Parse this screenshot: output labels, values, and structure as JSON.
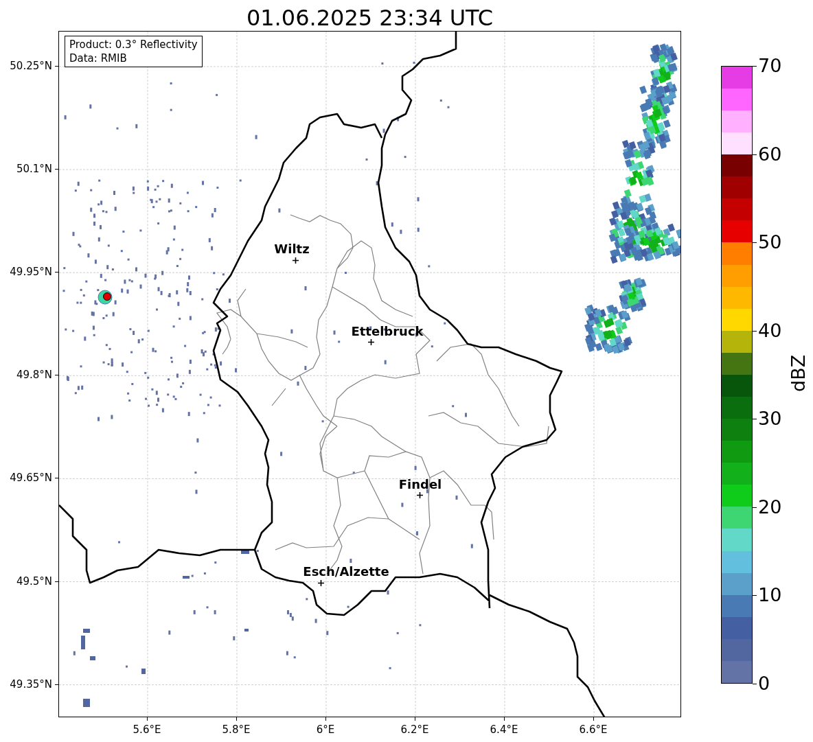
{
  "figure": {
    "title": "01.06.2025 23:34 UTC"
  },
  "map": {
    "info_box": [
      "Product: 0.3° Reflectivity",
      "Data: RMIB"
    ],
    "x_ticks": [
      "5.6°E",
      "5.8°E",
      "6°E",
      "6.2°E",
      "6.4°E",
      "6.6°E"
    ],
    "y_ticks": [
      "50.25°N",
      "50.1°N",
      "49.95°N",
      "49.8°N",
      "49.65°N",
      "49.5°N",
      "49.35°N"
    ],
    "cities": [
      {
        "name": "Wiltz"
      },
      {
        "name": "Ettelbruck"
      },
      {
        "name": "Findel"
      },
      {
        "name": "Esch/Alzette"
      }
    ]
  },
  "colorbar": {
    "label": "dBZ",
    "ticks": [
      "70",
      "60",
      "50",
      "40",
      "30",
      "20",
      "10",
      "0"
    ],
    "bands": [
      {
        "color": "#6473a6"
      },
      {
        "color": "#52679f"
      },
      {
        "color": "#4460a3"
      },
      {
        "color": "#4a7ab3"
      },
      {
        "color": "#5aa0cb"
      },
      {
        "color": "#62c0de"
      },
      {
        "color": "#62d8c8"
      },
      {
        "color": "#3dd672"
      },
      {
        "color": "#10cc1a"
      },
      {
        "color": "#12b01a"
      },
      {
        "color": "#109a12"
      },
      {
        "color": "#0d8010"
      },
      {
        "color": "#0a6e0e"
      },
      {
        "color": "#08560c"
      },
      {
        "color": "#457512"
      },
      {
        "color": "#b4b40a"
      },
      {
        "color": "#ffd800"
      },
      {
        "color": "#ffb800"
      },
      {
        "color": "#ff9e00"
      },
      {
        "color": "#ff7e00"
      },
      {
        "color": "#e60000"
      },
      {
        "color": "#c40000"
      },
      {
        "color": "#a00000"
      },
      {
        "color": "#780000"
      },
      {
        "color": "#ffe0ff"
      },
      {
        "color": "#ffb0ff"
      },
      {
        "color": "#ff66ff"
      },
      {
        "color": "#e63ce6"
      }
    ]
  }
}
